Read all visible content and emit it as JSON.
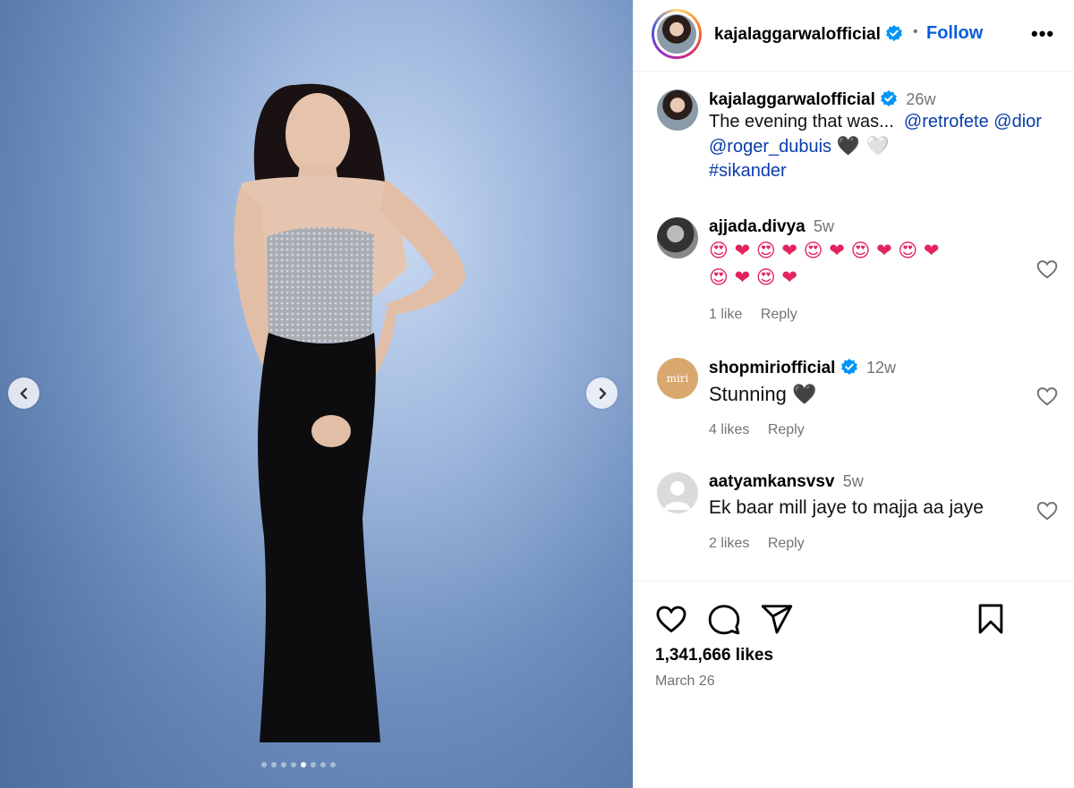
{
  "post": {
    "username": "kajalaggarwalofficial",
    "follow_label": "Follow",
    "separator": "•",
    "more_label": "•••",
    "caption": {
      "time": "26w",
      "text": "The evening that was...",
      "mention_1": "@retrofete",
      "mention_2": "@dior",
      "mention_3": "@roger_dubuis",
      "mention_3_emojis": "🖤 🤍",
      "hashtag": "#sikander"
    },
    "likes": "1,341,666 likes",
    "date": "March 26",
    "carousel": {
      "slide_count": 8,
      "active_slide": 4
    }
  },
  "comments": [
    {
      "username": "ajjada.divya",
      "time": "5w",
      "text_line_1": "😍 ❤ 😍 ❤ 😍 ❤ 😍 ❤ 😍 ❤",
      "text_line_2": "😍 ❤ 😍 ❤",
      "likes": "1 like",
      "reply": "Reply"
    },
    {
      "username": "shopmiriofficial",
      "avatar_text": "miri",
      "time": "12w",
      "text": "Stunning 🖤",
      "likes": "4 likes",
      "reply": "Reply"
    },
    {
      "username": "aatyamkansvsv",
      "time": "5w",
      "text": "Ek baar mill jaye to majja aa jaye",
      "likes": "2 likes",
      "reply": "Reply"
    }
  ],
  "colors": {
    "link": "#0a3ea8",
    "follow": "#0a5ce0",
    "verified": "#0095f6",
    "muted": "#737373"
  },
  "icons": [
    "chevron-left-icon",
    "chevron-right-icon",
    "verified-badge-icon",
    "more-icon",
    "heart-icon",
    "comment-icon",
    "share-icon",
    "bookmark-icon"
  ]
}
